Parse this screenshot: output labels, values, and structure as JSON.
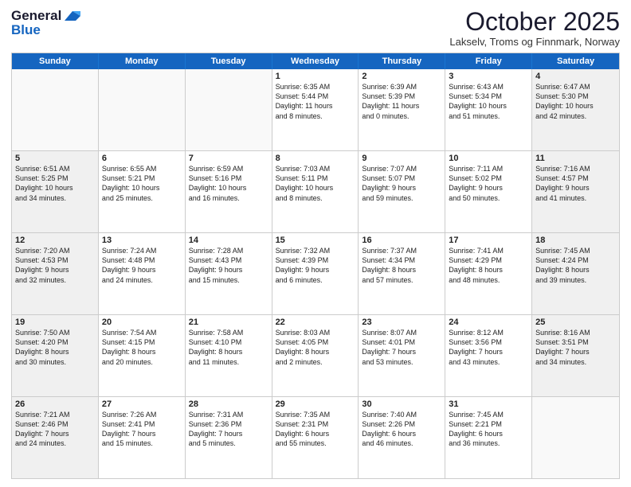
{
  "header": {
    "logo_line1": "General",
    "logo_line2": "Blue",
    "title": "October 2025",
    "subtitle": "Lakselv, Troms og Finnmark, Norway"
  },
  "days": [
    "Sunday",
    "Monday",
    "Tuesday",
    "Wednesday",
    "Thursday",
    "Friday",
    "Saturday"
  ],
  "weeks": [
    [
      {
        "day": "",
        "text": ""
      },
      {
        "day": "",
        "text": ""
      },
      {
        "day": "",
        "text": ""
      },
      {
        "day": "1",
        "text": "Sunrise: 6:35 AM\nSunset: 5:44 PM\nDaylight: 11 hours\nand 8 minutes."
      },
      {
        "day": "2",
        "text": "Sunrise: 6:39 AM\nSunset: 5:39 PM\nDaylight: 11 hours\nand 0 minutes."
      },
      {
        "day": "3",
        "text": "Sunrise: 6:43 AM\nSunset: 5:34 PM\nDaylight: 10 hours\nand 51 minutes."
      },
      {
        "day": "4",
        "text": "Sunrise: 6:47 AM\nSunset: 5:30 PM\nDaylight: 10 hours\nand 42 minutes."
      }
    ],
    [
      {
        "day": "5",
        "text": "Sunrise: 6:51 AM\nSunset: 5:25 PM\nDaylight: 10 hours\nand 34 minutes."
      },
      {
        "day": "6",
        "text": "Sunrise: 6:55 AM\nSunset: 5:21 PM\nDaylight: 10 hours\nand 25 minutes."
      },
      {
        "day": "7",
        "text": "Sunrise: 6:59 AM\nSunset: 5:16 PM\nDaylight: 10 hours\nand 16 minutes."
      },
      {
        "day": "8",
        "text": "Sunrise: 7:03 AM\nSunset: 5:11 PM\nDaylight: 10 hours\nand 8 minutes."
      },
      {
        "day": "9",
        "text": "Sunrise: 7:07 AM\nSunset: 5:07 PM\nDaylight: 9 hours\nand 59 minutes."
      },
      {
        "day": "10",
        "text": "Sunrise: 7:11 AM\nSunset: 5:02 PM\nDaylight: 9 hours\nand 50 minutes."
      },
      {
        "day": "11",
        "text": "Sunrise: 7:16 AM\nSunset: 4:57 PM\nDaylight: 9 hours\nand 41 minutes."
      }
    ],
    [
      {
        "day": "12",
        "text": "Sunrise: 7:20 AM\nSunset: 4:53 PM\nDaylight: 9 hours\nand 32 minutes."
      },
      {
        "day": "13",
        "text": "Sunrise: 7:24 AM\nSunset: 4:48 PM\nDaylight: 9 hours\nand 24 minutes."
      },
      {
        "day": "14",
        "text": "Sunrise: 7:28 AM\nSunset: 4:43 PM\nDaylight: 9 hours\nand 15 minutes."
      },
      {
        "day": "15",
        "text": "Sunrise: 7:32 AM\nSunset: 4:39 PM\nDaylight: 9 hours\nand 6 minutes."
      },
      {
        "day": "16",
        "text": "Sunrise: 7:37 AM\nSunset: 4:34 PM\nDaylight: 8 hours\nand 57 minutes."
      },
      {
        "day": "17",
        "text": "Sunrise: 7:41 AM\nSunset: 4:29 PM\nDaylight: 8 hours\nand 48 minutes."
      },
      {
        "day": "18",
        "text": "Sunrise: 7:45 AM\nSunset: 4:24 PM\nDaylight: 8 hours\nand 39 minutes."
      }
    ],
    [
      {
        "day": "19",
        "text": "Sunrise: 7:50 AM\nSunset: 4:20 PM\nDaylight: 8 hours\nand 30 minutes."
      },
      {
        "day": "20",
        "text": "Sunrise: 7:54 AM\nSunset: 4:15 PM\nDaylight: 8 hours\nand 20 minutes."
      },
      {
        "day": "21",
        "text": "Sunrise: 7:58 AM\nSunset: 4:10 PM\nDaylight: 8 hours\nand 11 minutes."
      },
      {
        "day": "22",
        "text": "Sunrise: 8:03 AM\nSunset: 4:05 PM\nDaylight: 8 hours\nand 2 minutes."
      },
      {
        "day": "23",
        "text": "Sunrise: 8:07 AM\nSunset: 4:01 PM\nDaylight: 7 hours\nand 53 minutes."
      },
      {
        "day": "24",
        "text": "Sunrise: 8:12 AM\nSunset: 3:56 PM\nDaylight: 7 hours\nand 43 minutes."
      },
      {
        "day": "25",
        "text": "Sunrise: 8:16 AM\nSunset: 3:51 PM\nDaylight: 7 hours\nand 34 minutes."
      }
    ],
    [
      {
        "day": "26",
        "text": "Sunrise: 7:21 AM\nSunset: 2:46 PM\nDaylight: 7 hours\nand 24 minutes."
      },
      {
        "day": "27",
        "text": "Sunrise: 7:26 AM\nSunset: 2:41 PM\nDaylight: 7 hours\nand 15 minutes."
      },
      {
        "day": "28",
        "text": "Sunrise: 7:31 AM\nSunset: 2:36 PM\nDaylight: 7 hours\nand 5 minutes."
      },
      {
        "day": "29",
        "text": "Sunrise: 7:35 AM\nSunset: 2:31 PM\nDaylight: 6 hours\nand 55 minutes."
      },
      {
        "day": "30",
        "text": "Sunrise: 7:40 AM\nSunset: 2:26 PM\nDaylight: 6 hours\nand 46 minutes."
      },
      {
        "day": "31",
        "text": "Sunrise: 7:45 AM\nSunset: 2:21 PM\nDaylight: 6 hours\nand 36 minutes."
      },
      {
        "day": "",
        "text": ""
      }
    ]
  ]
}
